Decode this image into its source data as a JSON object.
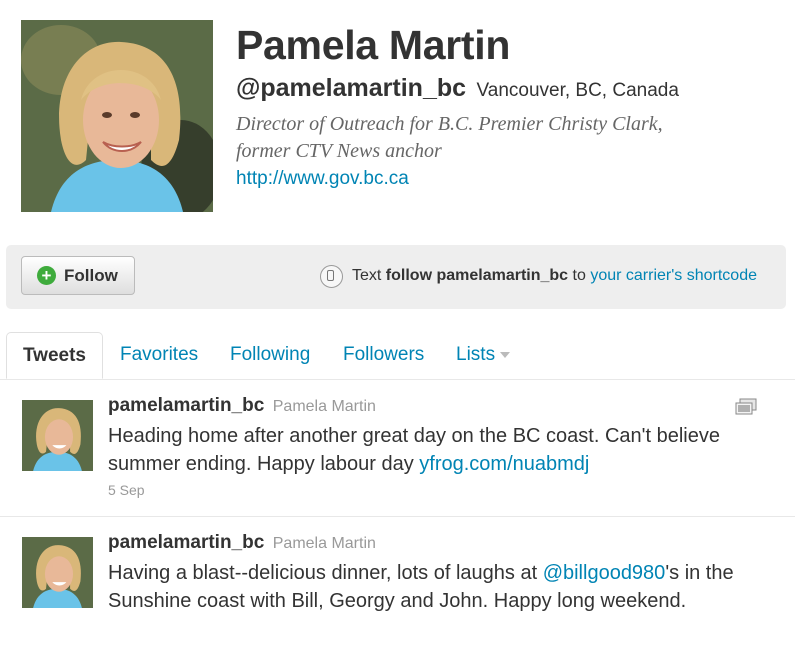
{
  "profile": {
    "name": "Pamela Martin",
    "screen_name": "@pamelamartin_bc",
    "location": "Vancouver, BC, Canada",
    "bio_line1": "Director of Outreach for B.C. Premier Christy Clark,",
    "bio_line2": "former CTV News anchor",
    "url": "http://www.gov.bc.ca"
  },
  "follow_bar": {
    "follow_label": "Follow",
    "sms_prefix": "Text",
    "sms_command": "follow pamelamartin_bc",
    "sms_to": "to",
    "sms_link": "your carrier's shortcode"
  },
  "tabs": [
    {
      "label": "Tweets",
      "active": true
    },
    {
      "label": "Favorites"
    },
    {
      "label": "Following"
    },
    {
      "label": "Followers"
    },
    {
      "label": "Lists"
    }
  ],
  "tweets": [
    {
      "screen_name": "pamelamartin_bc",
      "full_name": "Pamela Martin",
      "text_before": "Heading home after another great day on the BC coast. Can't believe summer ending. Happy labour day ",
      "link": "yfrog.com/nuabmdj",
      "text_after": "",
      "time": "5 Sep",
      "has_media": true
    },
    {
      "screen_name": "pamelamartin_bc",
      "full_name": "Pamela Martin",
      "text_before": "Having a blast--delicious dinner, lots of laughs at ",
      "link": "@billgood980",
      "text_after": "'s in the Sunshine coast with Bill, Georgy and John. Happy long weekend.",
      "time": "",
      "has_media": false
    }
  ],
  "colors": {
    "link": "#0084b4",
    "text": "#333333",
    "muted": "#999999",
    "follow_plus": "#3eab3c"
  },
  "icons": [
    "plus-icon",
    "phone-icon",
    "dropdown-caret-icon",
    "media-icon"
  ]
}
